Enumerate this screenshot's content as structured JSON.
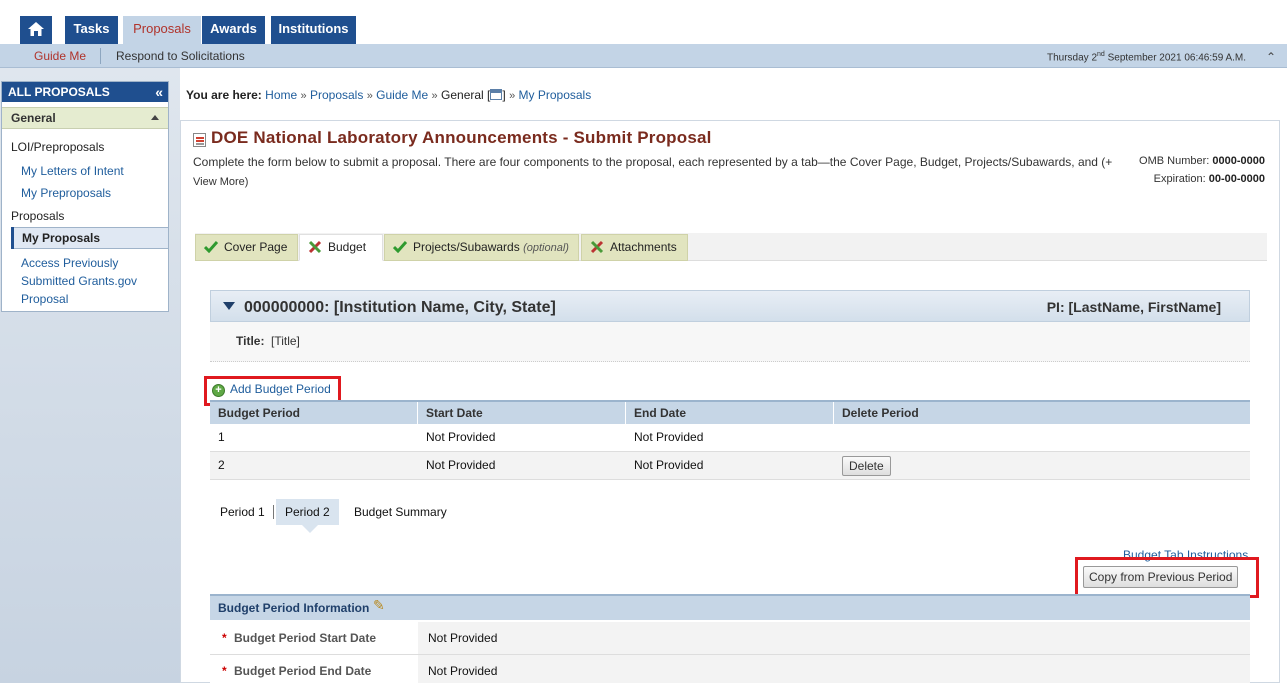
{
  "top_nav": {
    "home_icon": "home-icon",
    "tabs": [
      "Tasks",
      "Proposals",
      "Awards",
      "Institutions"
    ],
    "active_tab": "Proposals"
  },
  "sub_nav": {
    "items": [
      "Guide Me",
      "Respond to Solicitations"
    ],
    "active_item": "Guide Me",
    "datetime_prefix": "Thursday 2",
    "datetime_suffix": "nd",
    "datetime_rest": " September 2021 06:46:59 A.M."
  },
  "sidebar": {
    "header": "ALL PROPOSALS",
    "collapse_icon": "double-chevron-left-icon",
    "section": "General",
    "groups": {
      "loi_title": "LOI/Preproposals",
      "loi_items": [
        "My Letters of Intent",
        "My Preproposals"
      ],
      "proposals_title": "Proposals",
      "active_item": "My Proposals",
      "access_item": "Access Previously Submitted Grants.gov Proposal"
    }
  },
  "breadcrumb": {
    "label": "You are here:",
    "items": [
      "Home",
      "Proposals",
      "Guide Me",
      "General [",
      "]",
      "My Proposals"
    ],
    "separator": "»"
  },
  "page": {
    "title": "DOE National Laboratory Announcements - Submit Proposal",
    "description": "Complete the form below to submit a proposal. There are four components to the proposal, each represented by a tab—the Cover Page, Budget, Projects/Subawards, and (+",
    "view_more": "View More",
    "view_more_close": ")",
    "omb_label": "OMB Number:",
    "omb_value": "0000-0000",
    "expiration_label": "Expiration:",
    "expiration_value": "00-00-0000"
  },
  "component_tabs": [
    {
      "label": "Cover Page",
      "status": "check"
    },
    {
      "label": "Budget",
      "status": "incomplete"
    },
    {
      "label": "Projects/Subawards",
      "optional": "(optional)",
      "status": "check"
    },
    {
      "label": "Attachments",
      "status": "incomplete"
    }
  ],
  "institution": {
    "name": "000000000: [Institution Name, City, State]",
    "pi": "PI: [LastName, FirstName]",
    "title_label": "Title:",
    "title_value": "[Title]"
  },
  "budget": {
    "add_label": "Add Budget Period",
    "columns": [
      "Budget Period",
      "Start Date",
      "End Date",
      "Delete Period"
    ],
    "rows": [
      {
        "period": "1",
        "start": "Not Provided",
        "end": "Not Provided",
        "delete": ""
      },
      {
        "period": "2",
        "start": "Not Provided",
        "end": "Not Provided",
        "delete": "Delete"
      }
    ],
    "period_tabs": [
      "Period 1",
      "Period 2",
      "Budget Summary"
    ],
    "active_period_tab": "Period 2",
    "instructions_link": "Budget Tab Instructions",
    "copy_button": "Copy from Previous Period",
    "info_header": "Budget Period Information",
    "info_rows": [
      {
        "label": "Budget Period Start Date",
        "value": "Not Provided"
      },
      {
        "label": "Budget Period End Date",
        "value": "Not Provided"
      }
    ]
  },
  "colors": {
    "nav_blue": "#1f4f8f",
    "highlight_red": "#e0191f",
    "title_brown": "#7a2b1e",
    "tab_olive": "#e1e4bf"
  }
}
